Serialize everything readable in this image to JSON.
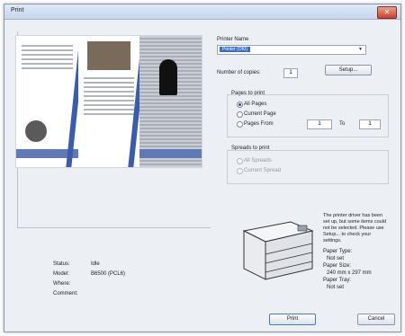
{
  "window": {
    "title": "Print",
    "close_glyph": "✕"
  },
  "printer": {
    "label": "Printer Name",
    "selected": "Printer (OKI)"
  },
  "copies": {
    "label": "Number of copies:",
    "value": "1",
    "setup_label": "Setup..."
  },
  "pages": {
    "label": "Pages to print",
    "options": [
      "All Pages",
      "Current Page",
      "Pages From"
    ],
    "to_label": "To",
    "from_value": "1",
    "to_value": "1"
  },
  "spreads": {
    "label": "Spreads to print",
    "options": [
      "All Spreads",
      "Current Spread"
    ]
  },
  "status": {
    "rows": [
      {
        "label": "Status:",
        "value": "Idle"
      },
      {
        "label": "Model:",
        "value": "B6500 (PCL6)"
      },
      {
        "label": "Where:",
        "value": ""
      },
      {
        "label": "Comment:",
        "value": ""
      }
    ]
  },
  "info": {
    "text": "The printer driver has been set up, but some items could not be selected. Please use Setup... to check your settings.",
    "paper_type_label": "Paper Type:",
    "paper_type_value": "Not set",
    "paper_size_label": "Paper Size:",
    "paper_size_value": "240 mm x 297 mm",
    "paper_tray_label": "Paper Tray:",
    "paper_tray_value": "Not set"
  },
  "buttons": {
    "print": "Print",
    "cancel": "Cancel"
  }
}
